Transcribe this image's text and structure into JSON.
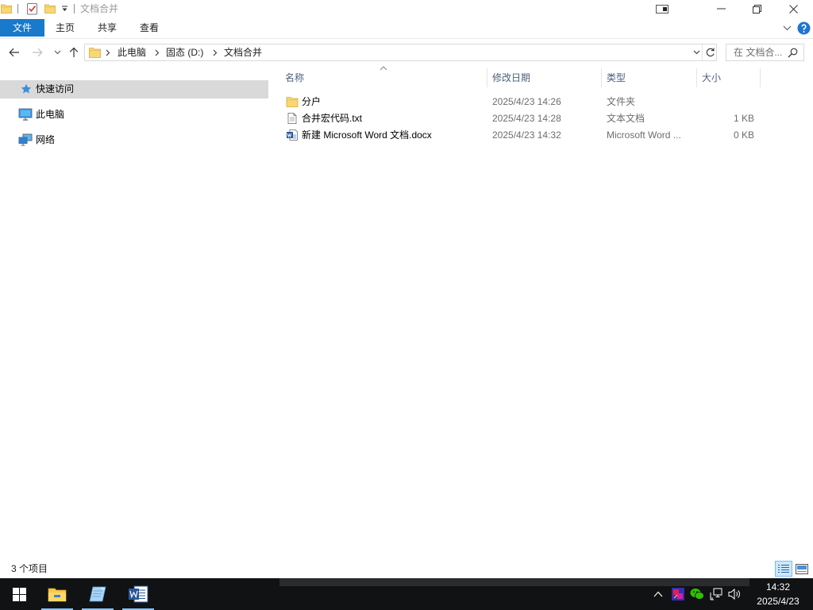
{
  "window": {
    "title": "文档合并",
    "quick_access_toolbar": [
      "folder-icon",
      "properties-icon",
      "new-folder-icon",
      "customize-dropdown-icon"
    ],
    "controls": [
      "tablet-mode-icon",
      "minimize-icon",
      "restore-icon",
      "close-icon"
    ]
  },
  "ribbon": {
    "tabs": [
      {
        "label": "文件",
        "active": true
      },
      {
        "label": "主页",
        "active": false
      },
      {
        "label": "共享",
        "active": false
      },
      {
        "label": "查看",
        "active": false
      }
    ],
    "right_icons": [
      "chevron-down-icon",
      "help-icon"
    ]
  },
  "navigation": {
    "buttons": [
      "back-arrow-icon",
      "forward-arrow-icon",
      "recent-locations-chevron-icon",
      "up-arrow-icon"
    ],
    "address": {
      "icon": "folder-icon",
      "crumbs": [
        "此电脑",
        "固态 (D:)",
        "文档合并"
      ],
      "buttons": [
        "address-dropdown-icon",
        "refresh-icon"
      ]
    },
    "search": {
      "placeholder": "在 文档合...",
      "icon": "search-icon"
    }
  },
  "nav_pane": {
    "items": [
      {
        "label": "快速访问",
        "icon": "star-icon",
        "selected": true
      },
      {
        "label": "此电脑",
        "icon": "computer-icon",
        "selected": false
      },
      {
        "label": "网络",
        "icon": "network-icon",
        "selected": false
      }
    ]
  },
  "file_list": {
    "columns": [
      "名称",
      "修改日期",
      "类型",
      "大小"
    ],
    "sort_icon": "sort-ascending-icon",
    "rows": [
      {
        "name": "分户",
        "date": "2025/4/23 14:26",
        "type": "文件夹",
        "size": "",
        "icon": "folder-icon"
      },
      {
        "name": "合并宏代码.txt",
        "date": "2025/4/23 14:28",
        "type": "文本文档",
        "size": "1 KB",
        "icon": "text-file-icon"
      },
      {
        "name": "新建 Microsoft Word 文档.docx",
        "date": "2025/4/23 14:32",
        "type": "Microsoft Word ...",
        "size": "0 KB",
        "icon": "word-document-icon"
      }
    ]
  },
  "status_bar": {
    "item_count": "3 个项目",
    "views": [
      {
        "icon": "details-view-icon",
        "selected": true
      },
      {
        "icon": "large-icons-view-icon",
        "selected": false
      }
    ]
  },
  "taskbar": {
    "start_icon": "windows-logo-icon",
    "apps": [
      {
        "icon": "file-explorer-icon",
        "running": true
      },
      {
        "icon": "notes-app-icon",
        "running": true
      },
      {
        "icon": "word-app-icon",
        "running": true
      }
    ],
    "tray_icons": [
      "chevron-up-icon",
      "app-tray-icon",
      "wechat-icon",
      "network-status-icon",
      "volume-icon"
    ],
    "clock": {
      "time": "14:32",
      "date": "2025/4/23"
    }
  },
  "colors": {
    "accent": "#1979ca",
    "selection": "#d9d9d9",
    "help": "#1e75d0",
    "secondary_text": "#6d6d6d",
    "folder": "#f8d775",
    "taskbar": "#111214",
    "word": "#2b579a",
    "wechat": "#2dc100"
  }
}
